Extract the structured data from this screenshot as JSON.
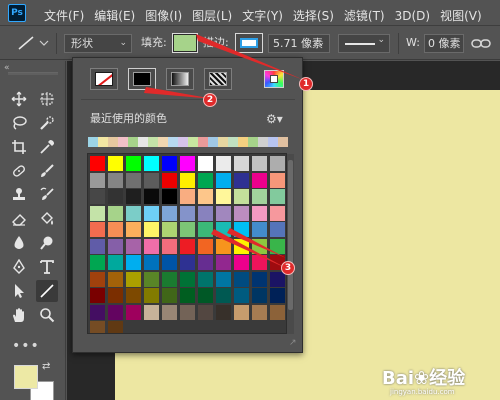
{
  "app": {
    "logo": "Ps"
  },
  "menu": [
    {
      "label": "文件(F)"
    },
    {
      "label": "编辑(E)"
    },
    {
      "label": "图像(I)"
    },
    {
      "label": "图层(L)"
    },
    {
      "label": "文字(Y)"
    },
    {
      "label": "选择(S)"
    },
    {
      "label": "滤镜(T)"
    },
    {
      "label": "3D(D)"
    },
    {
      "label": "视图(V)"
    }
  ],
  "options": {
    "mode": "形状",
    "fill_label": "填充:",
    "fill_color": "#a6d38a",
    "stroke_label": "描边:",
    "stroke_color": "#2e9fe6",
    "stroke_width": "5.71 像素",
    "w_label": "W:",
    "w_value": "0 像素"
  },
  "tools": [
    {
      "icon": "move-tool-icon"
    },
    {
      "icon": "artboard-tool-icon"
    },
    {
      "icon": "lasso-tool-icon"
    },
    {
      "icon": "quick-select-tool-icon"
    },
    {
      "icon": "crop-tool-icon"
    },
    {
      "icon": "eyedropper-tool-icon"
    },
    {
      "icon": "spot-healing-tool-icon"
    },
    {
      "icon": "brush-tool-icon"
    },
    {
      "icon": "clone-stamp-tool-icon"
    },
    {
      "icon": "history-brush-tool-icon"
    },
    {
      "icon": "eraser-tool-icon"
    },
    {
      "icon": "paint-bucket-tool-icon"
    },
    {
      "icon": "blur-tool-icon"
    },
    {
      "icon": "dodge-tool-icon"
    },
    {
      "icon": "pen-tool-icon"
    },
    {
      "icon": "type-tool-icon"
    },
    {
      "icon": "path-select-tool-icon"
    },
    {
      "icon": "line-tool-icon"
    },
    {
      "icon": "hand-tool-icon"
    },
    {
      "icon": "zoom-tool-icon"
    }
  ],
  "toolbar": {
    "more": "•••"
  },
  "colors": {
    "foreground": "#ede9a5",
    "background": "#ffffff",
    "canvas": "#ede7a2"
  },
  "panel": {
    "recent_label": "最近使用的颜色",
    "recent_colors": [
      "#9cd4e6",
      "#f2e6a2",
      "#e6c8a0",
      "#f2c0c8",
      "#a6d38a",
      "#e6e6e6",
      "#c4e3a8",
      "#f0d6b0",
      "#b7d9f0",
      "#d6c4ea",
      "#c8e6a0",
      "#ea9a9a",
      "#a0c8e6",
      "#e6d6a0",
      "#c0e0c0",
      "#f4d080",
      "#a6d38a",
      "#d0d0d0",
      "#b8c4f0",
      "#e0c0a0"
    ],
    "swatch_grid": [
      [
        "#ff0000",
        "#ffff00",
        "#00ff00",
        "#00ffff",
        "#0000ff",
        "#ff00ff",
        "#ffffff",
        "#ebebeb",
        "#d6d6d6",
        "#c2c2c2",
        "#adadad"
      ],
      [
        "#999999",
        "#858585",
        "#707070",
        "#5c5c5c",
        "#ec0000",
        "#ffef00",
        "#00a651",
        "#00aeef",
        "#2e3192",
        "#ec008c",
        "#f7977a"
      ],
      [
        "#474747",
        "#333333",
        "#1f1f1f",
        "#0a0a0a",
        "#000000",
        "#f9ad81",
        "#fdc68a",
        "#fff79a",
        "#c4df9b",
        "#a2d39c",
        "#82ca9d"
      ],
      [
        "#c4e3a8",
        "#a6d38a",
        "#7bcdc8",
        "#6ecff6",
        "#7ea7d8",
        "#8493ca",
        "#8882be",
        "#a187be",
        "#bc8dbf",
        "#f49ac2",
        "#f6989d"
      ],
      [
        "#f26c4f",
        "#f68e55",
        "#fbaf5c",
        "#fff467",
        "#acd372",
        "#7cc576",
        "#3bb878",
        "#1abbb4",
        "#00bff3",
        "#438ccb",
        "#5574b9"
      ],
      [
        "#605ca8",
        "#855fa8",
        "#a763a8",
        "#f06ea9",
        "#f26d7d",
        "#ed1c24",
        "#f26522",
        "#f7941d",
        "#fff200",
        "#8dc73f",
        "#39b54a"
      ],
      [
        "#00a651",
        "#00a99d",
        "#00aeef",
        "#0072bc",
        "#0054a6",
        "#2e3192",
        "#662d91",
        "#92278f",
        "#ec008c",
        "#ed145b",
        "#9e0b0f"
      ],
      [
        "#a0410d",
        "#a36209",
        "#aba000",
        "#598527",
        "#1a7b30",
        "#007236",
        "#00746b",
        "#0076a3",
        "#004b80",
        "#003471",
        "#1b1464"
      ],
      [
        "#790000",
        "#7b2e00",
        "#7d4900",
        "#827b00",
        "#406618",
        "#005e20",
        "#005826",
        "#005952",
        "#005b7f",
        "#003663",
        "#002157"
      ],
      [
        "#440e62",
        "#630460",
        "#9e005d",
        "#c7b299",
        "#998675",
        "#736357",
        "#534741",
        "#37302a",
        "#c69c6d",
        "#a67c52",
        "#8c6239"
      ],
      [
        "#754c24",
        "#603913"
      ]
    ]
  },
  "annotations": [
    {
      "label": "1"
    },
    {
      "label": "2"
    },
    {
      "label": "3"
    }
  ],
  "watermark": {
    "brand": "Bai❀经验",
    "sub": "jingyan.baidu.com"
  }
}
